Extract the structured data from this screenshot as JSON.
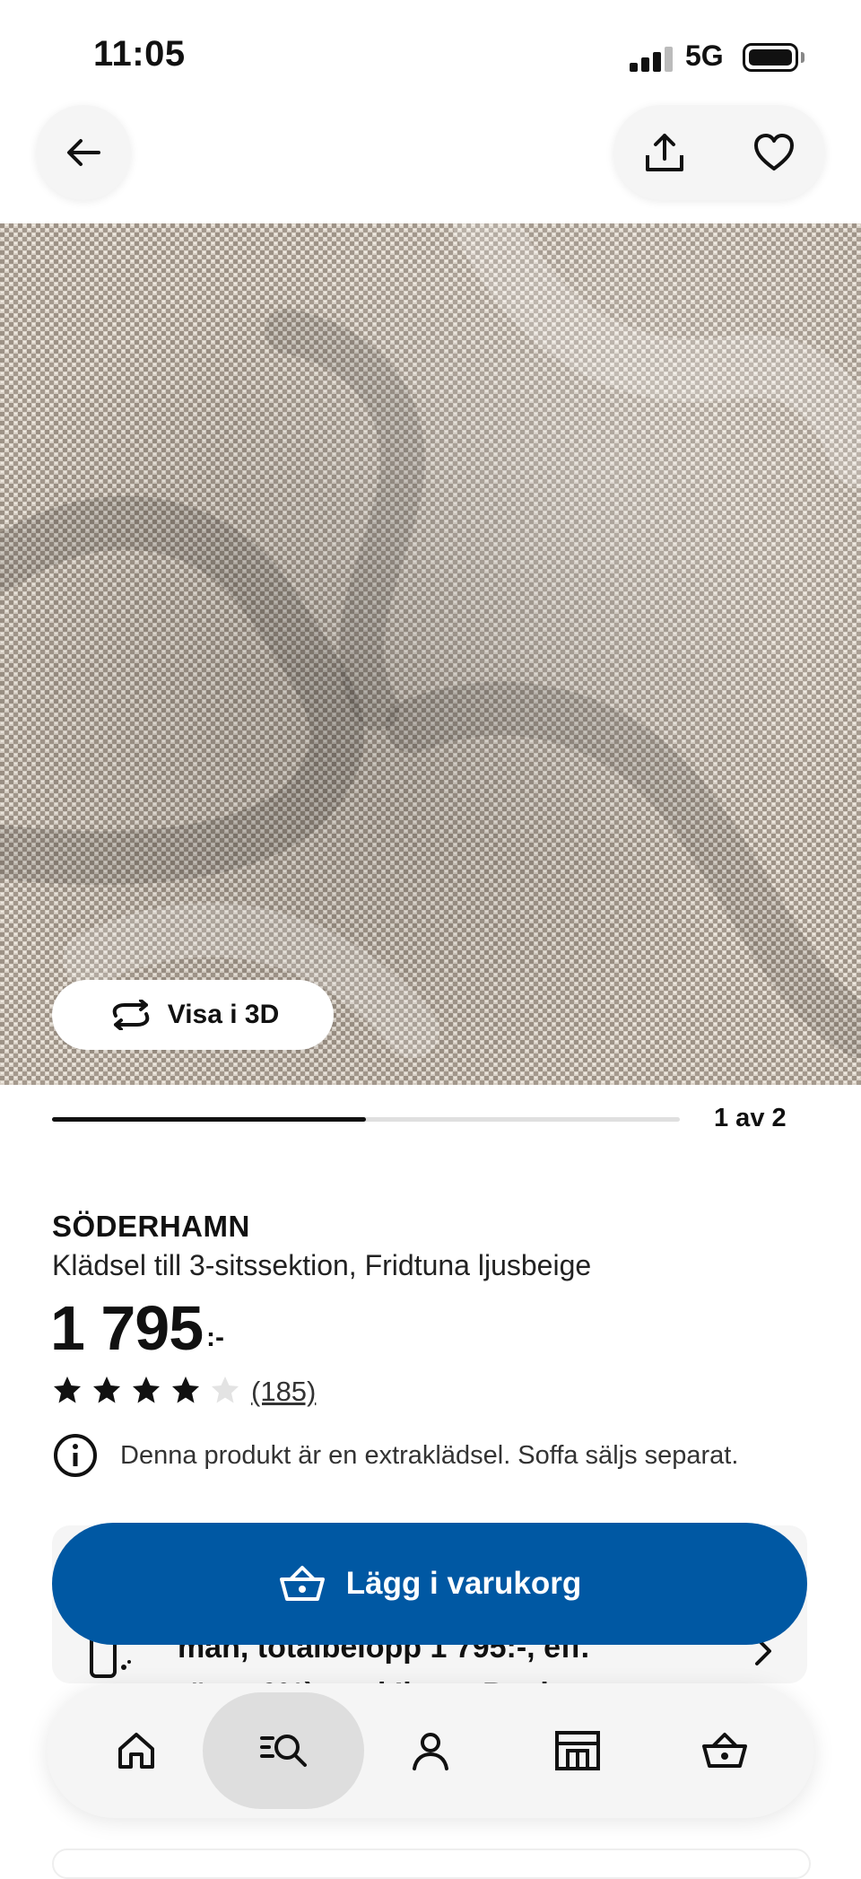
{
  "status_bar": {
    "time": "11:05",
    "network": "5G"
  },
  "product": {
    "brand": "SÖDERHAMN",
    "description": "Klädsel till 3-sitssektion, Fridtuna ljusbeige",
    "price": "1 795",
    "price_suffix": ":-",
    "rating": 4,
    "rating_max": 5,
    "reviews": "(185)",
    "info": "Denna produkt är en extraklädsel. Soffa säljs separat."
  },
  "gallery": {
    "view3d_label": "Visa i 3D",
    "page_indicator": "1 av 2",
    "progress": 0.5
  },
  "add_to_cart": {
    "label": "Lägg i varukorg"
  },
  "credit_banner": {
    "line1": "mån, totalbelopp 1 795:-, eff.",
    "line2": "ränta 0%) med Ikano Bank"
  },
  "tabbar": {
    "items": [
      "home-icon",
      "search-icon",
      "profile-icon",
      "store-icon",
      "cart-icon"
    ],
    "active": 1
  },
  "colors": {
    "primary_blue": "#0058a3",
    "surface": "#f5f5f5"
  }
}
